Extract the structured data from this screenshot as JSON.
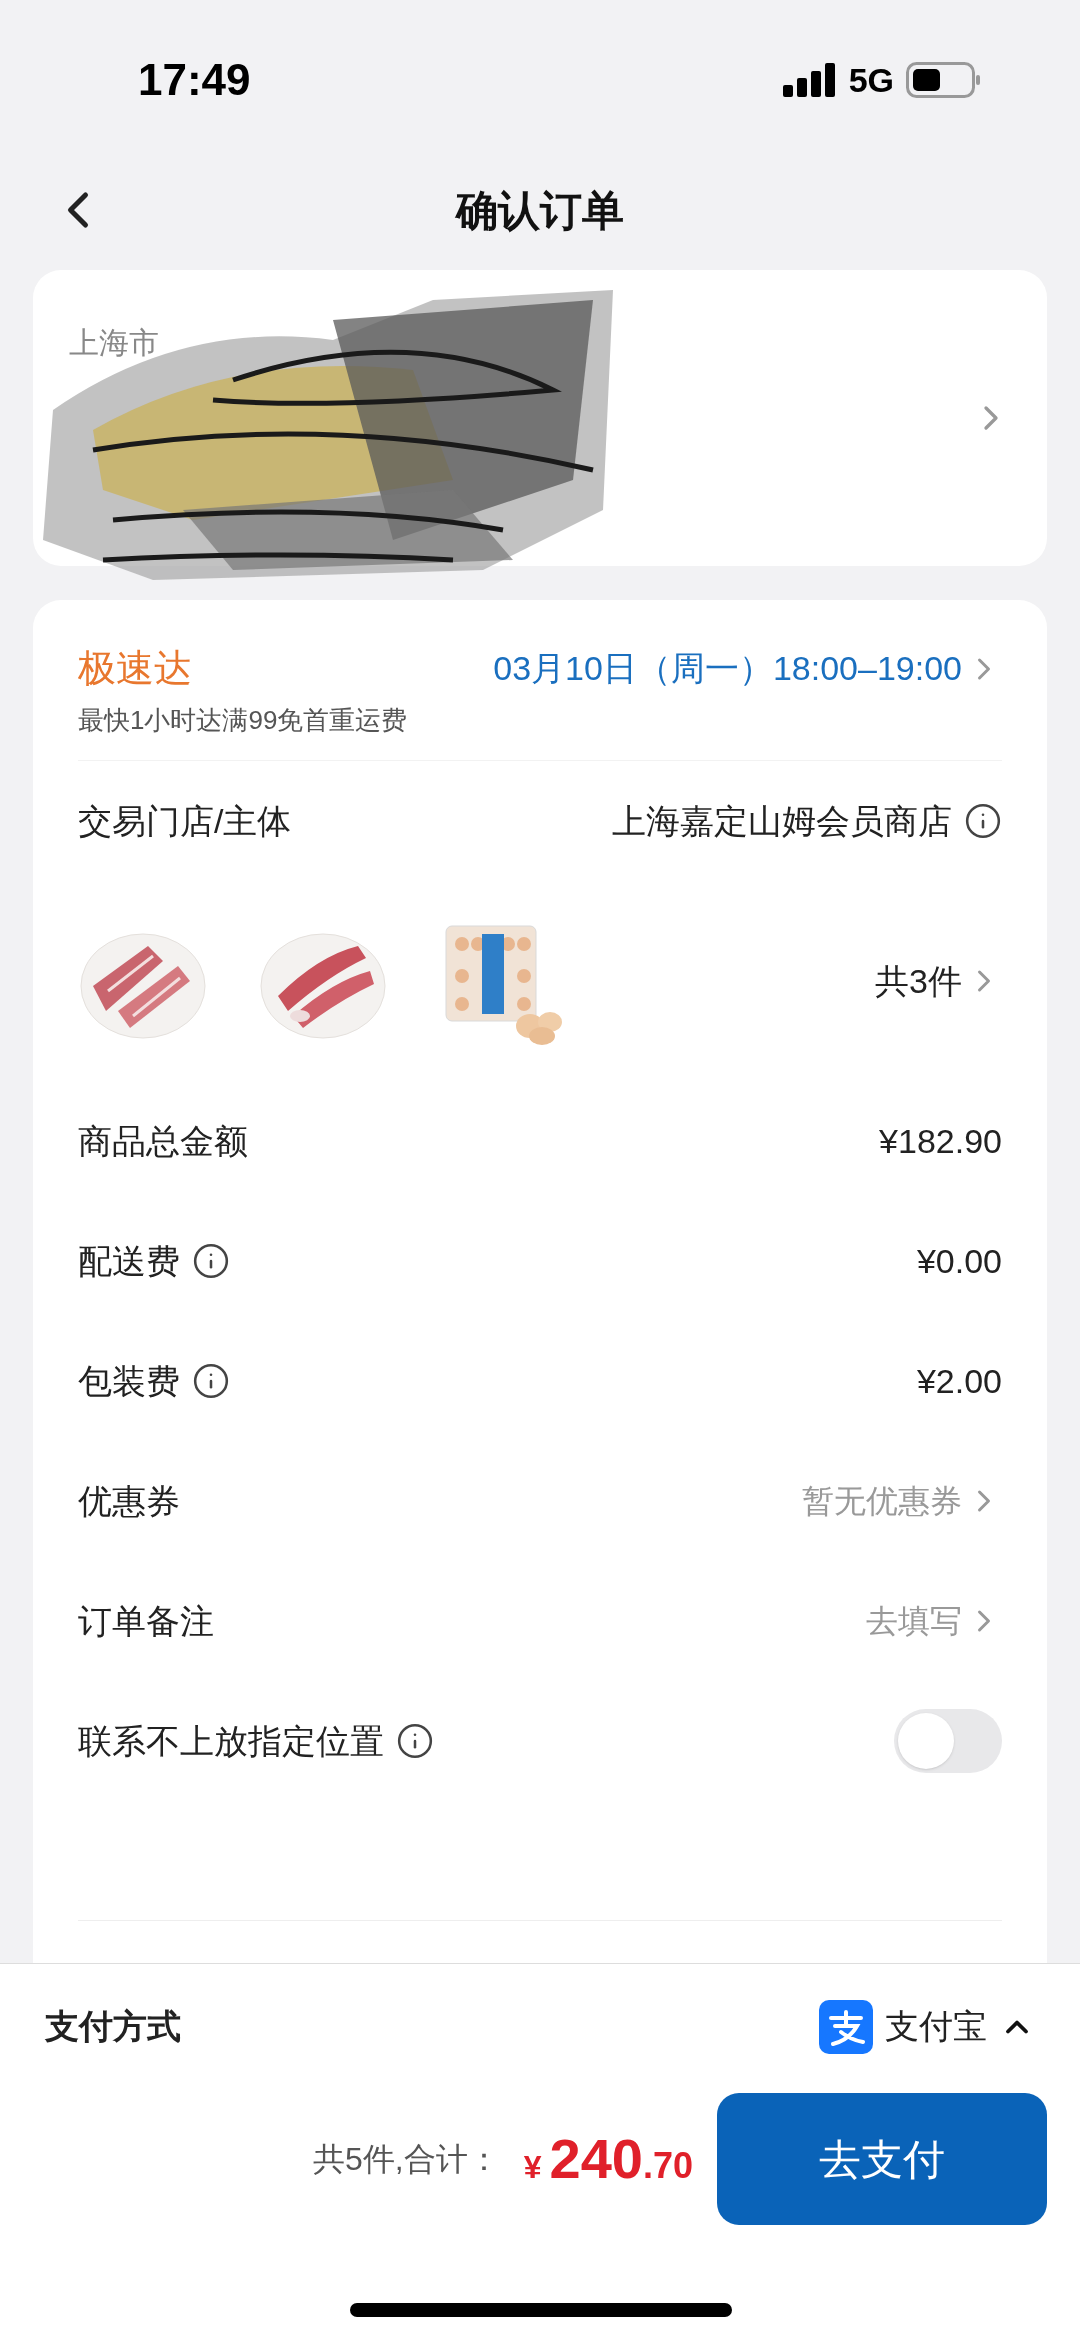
{
  "status_bar": {
    "time": "17:49",
    "network": "5G"
  },
  "nav": {
    "title": "确认订单"
  },
  "address": {
    "region": "上海市"
  },
  "delivery": {
    "name": "极速达",
    "slot": "03月10日（周一）18:00–19:00",
    "note": "最快1小时达满99免首重运费"
  },
  "store": {
    "label": "交易门店/主体",
    "value": "上海嘉定山姆会员商店"
  },
  "products": {
    "count": "共3件"
  },
  "rows": [
    {
      "kind": "amount",
      "label": "商品总金额",
      "value": "¥182.90",
      "info": false
    },
    {
      "kind": "amount",
      "label": "配送费",
      "value": "¥0.00",
      "info": true
    },
    {
      "kind": "amount",
      "label": "包装费",
      "value": "¥2.00",
      "info": true
    },
    {
      "kind": "link",
      "label": "优惠券",
      "value": "暂无优惠券",
      "info": false
    },
    {
      "kind": "link",
      "label": "订单备注",
      "value": "去填写",
      "info": false
    },
    {
      "kind": "toggle",
      "label": "联系不上放指定位置",
      "info": true,
      "on": false
    }
  ],
  "payment": {
    "label": "支付方式",
    "method": "支付宝",
    "expanded": true
  },
  "total": {
    "summary": "共5件,合计：",
    "currency": "¥",
    "integer": "240",
    "decimal": ".70",
    "button": "去支付"
  }
}
